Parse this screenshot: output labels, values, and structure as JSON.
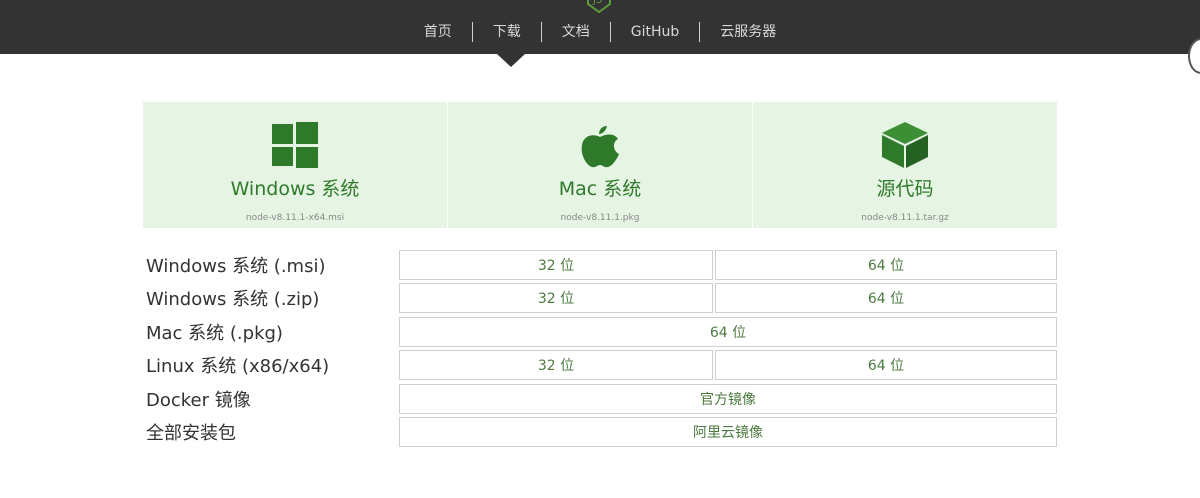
{
  "nav": {
    "items": [
      {
        "id": "home",
        "label": "首页"
      },
      {
        "id": "download",
        "label": "下载"
      },
      {
        "id": "docs",
        "label": "文档"
      },
      {
        "id": "github",
        "label": "GitHub"
      },
      {
        "id": "cloud",
        "label": "云服务器"
      }
    ],
    "active": "download"
  },
  "panels": [
    {
      "icon": "windows-icon",
      "title": "Windows 系统",
      "file": "node-v8.11.1-x64.msi"
    },
    {
      "icon": "apple-icon",
      "title": "Mac 系统",
      "file": "node-v8.11.1.pkg"
    },
    {
      "icon": "box-icon",
      "title": "源代码",
      "file": "node-v8.11.1.tar.gz"
    }
  ],
  "table": {
    "rows": [
      {
        "label": "Windows 系统 (.msi)",
        "cells": [
          "32 位",
          "64 位"
        ]
      },
      {
        "label": "Windows 系统 (.zip)",
        "cells": [
          "32 位",
          "64 位"
        ]
      },
      {
        "label": "Mac 系统 (.pkg)",
        "cells": [
          "64 位"
        ]
      },
      {
        "label": "Linux 系统 (x86/x64)",
        "cells": [
          "32 位",
          "64 位"
        ]
      },
      {
        "label": "Docker 镜像",
        "cells": [
          "官方镜像"
        ]
      },
      {
        "label": "全部安装包",
        "cells": [
          "阿里云镜像"
        ]
      }
    ]
  },
  "colors": {
    "accent": "#2f7a2a",
    "panel_bg": "#e6f4e4",
    "topbar": "#333333"
  }
}
